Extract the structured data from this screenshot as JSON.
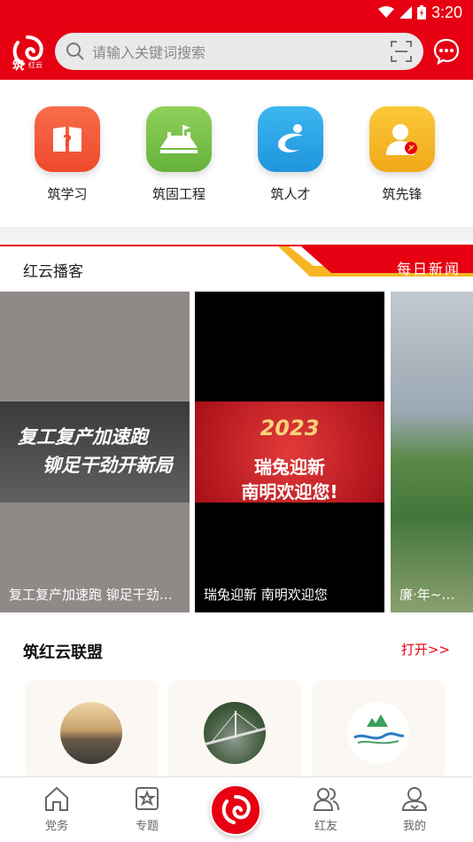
{
  "status_bar": {
    "time": "3:20"
  },
  "header": {
    "logo_sub": "红云",
    "search_placeholder": "请输入关键词搜索"
  },
  "quick_entries": [
    {
      "label": "筑学习",
      "icon": "study-icon",
      "color": "#f45a3c"
    },
    {
      "label": "筑固工程",
      "icon": "great-wall-icon",
      "color": "#7cc24a"
    },
    {
      "label": "筑人才",
      "icon": "talent-icon",
      "color": "#2ea7e8"
    },
    {
      "label": "筑先锋",
      "icon": "pioneer-icon",
      "color": "#f6b623"
    }
  ],
  "podcast": {
    "title": "红云播客",
    "tab_label": "每日新闻",
    "cards": [
      {
        "caption": "复工复产加速跑 铆足干劲开新局",
        "banner_line1": "复工复产加速跑",
        "banner_line2": "铆足干劲开新局"
      },
      {
        "caption": "瑞兔迎新 南明欢迎您",
        "banner_year": "2023",
        "banner_line1": "瑞兔迎新",
        "banner_line2": "南明欢迎您!"
      },
      {
        "caption": "廉·年~清简"
      }
    ]
  },
  "alliance": {
    "title": "筑红云联盟",
    "more_label": "打开>>"
  },
  "tabbar": {
    "items": [
      {
        "label": "党务",
        "icon": "home-icon"
      },
      {
        "label": "专题",
        "icon": "topic-icon"
      },
      {
        "label": "红友",
        "icon": "friends-icon"
      },
      {
        "label": "我的",
        "icon": "profile-icon"
      }
    ]
  },
  "colors": {
    "brand_red": "#e60012"
  }
}
